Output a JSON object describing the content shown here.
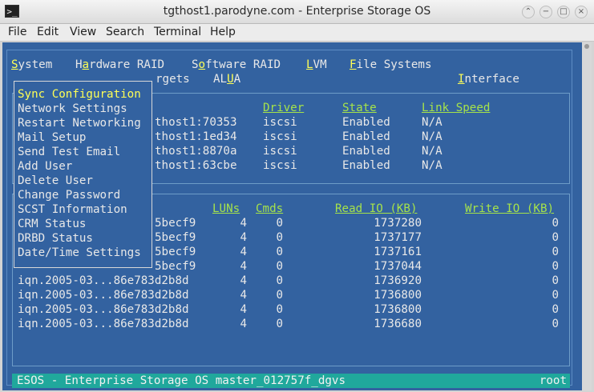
{
  "window": {
    "title": "tgthost1.parodyne.com - Enterprise Storage OS"
  },
  "menubar": [
    "File",
    "Edit",
    "View",
    "Search",
    "Terminal",
    "Help"
  ],
  "topmenu": [
    {
      "pre": "",
      "hot": "S",
      "post": "ystem"
    },
    {
      "pre": "H",
      "hot": "a",
      "post": "rdware RAID"
    },
    {
      "pre": "S",
      "hot": "o",
      "post": "ftware RAID"
    },
    {
      "pre": "",
      "hot": "L",
      "post": "VM"
    },
    {
      "pre": "",
      "hot": "F",
      "post": "ile Systems"
    }
  ],
  "second_row": {
    "targets": "rgets",
    "alua_pre": "AL",
    "alua_hot": "U",
    "alua_post": "A",
    "interface_hot": "I",
    "interface_post": "nterface"
  },
  "system_menu": {
    "items": [
      "Sync Configuration",
      "Network Settings",
      "Restart Networking",
      "Mail Setup",
      "Send Test Email",
      "Add User",
      "Delete User",
      "Change Password",
      "SCST Information",
      "CRM Status",
      "DRBD Status",
      "Date/Time Settings"
    ],
    "selected_index": 0
  },
  "targets_table": {
    "headers": {
      "driver": "Driver",
      "state": "State",
      "link_speed": "Link Speed"
    },
    "rows": [
      {
        "name": "thost1:70353",
        "driver": "iscsi",
        "state": "Enabled",
        "speed": "N/A"
      },
      {
        "name": "thost1:1ed34",
        "driver": "iscsi",
        "state": "Enabled",
        "speed": "N/A"
      },
      {
        "name": "thost1:8870a",
        "driver": "iscsi",
        "state": "Enabled",
        "speed": "N/A"
      },
      {
        "name": "thost1:63cbe",
        "driver": "iscsi",
        "state": "Enabled",
        "speed": "N/A"
      }
    ]
  },
  "sessions_table": {
    "headers": {
      "luns": "LUNs",
      "cmds": "Cmds",
      "read": "Read IO (KB)",
      "write": "Write IO (KB)"
    },
    "rows": [
      {
        "name": "5becf9",
        "luns": "4",
        "cmds": "0",
        "read": "1737280",
        "write": "0"
      },
      {
        "name": "5becf9",
        "luns": "4",
        "cmds": "0",
        "read": "1737177",
        "write": "0"
      },
      {
        "name": "5becf9",
        "luns": "4",
        "cmds": "0",
        "read": "1737161",
        "write": "0"
      },
      {
        "name": "5becf9",
        "luns": "4",
        "cmds": "0",
        "read": "1737044",
        "write": "0"
      },
      {
        "name": "iqn.2005-03...86e783d2b8d",
        "luns": "4",
        "cmds": "0",
        "read": "1736920",
        "write": "0"
      },
      {
        "name": "iqn.2005-03...86e783d2b8d",
        "luns": "4",
        "cmds": "0",
        "read": "1736800",
        "write": "0"
      },
      {
        "name": "iqn.2005-03...86e783d2b8d",
        "luns": "4",
        "cmds": "0",
        "read": "1736800",
        "write": "0"
      },
      {
        "name": "iqn.2005-03...86e783d2b8d",
        "luns": "4",
        "cmds": "0",
        "read": "1736680",
        "write": "0"
      }
    ]
  },
  "statusbar": {
    "left": "ESOS - Enterprise Storage OS master_012757f_dgvs",
    "right": "root"
  },
  "colors": {
    "terminal_bg": "#3362a0",
    "header": "#a6e34a",
    "highlight": "#ffff55",
    "status_bg": "#20a89c"
  }
}
